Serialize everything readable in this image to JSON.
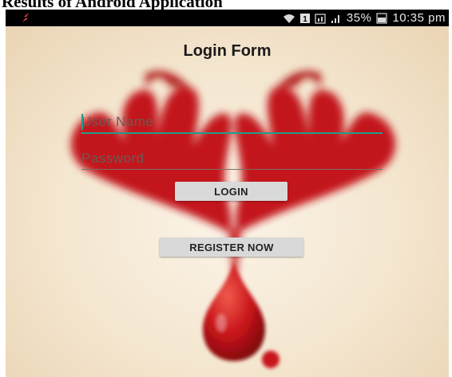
{
  "caption": "Results of Android Application",
  "status_bar": {
    "app_icon": "flame-icon",
    "icons": [
      "wifi-icon",
      "sim1-icon",
      "network-icon",
      "signal-icon"
    ],
    "battery": "35%",
    "battery_icon": "battery-icon",
    "time": "10:35 pm"
  },
  "form": {
    "title": "Login Form",
    "username_placeholder": "User Name",
    "password_placeholder": "Password",
    "login_label": "LOGIN",
    "register_label": "REGISTER NOW"
  },
  "colors": {
    "accent": "#1f9e8f",
    "blood": "#c8141a",
    "button": "#d9d9d9"
  }
}
